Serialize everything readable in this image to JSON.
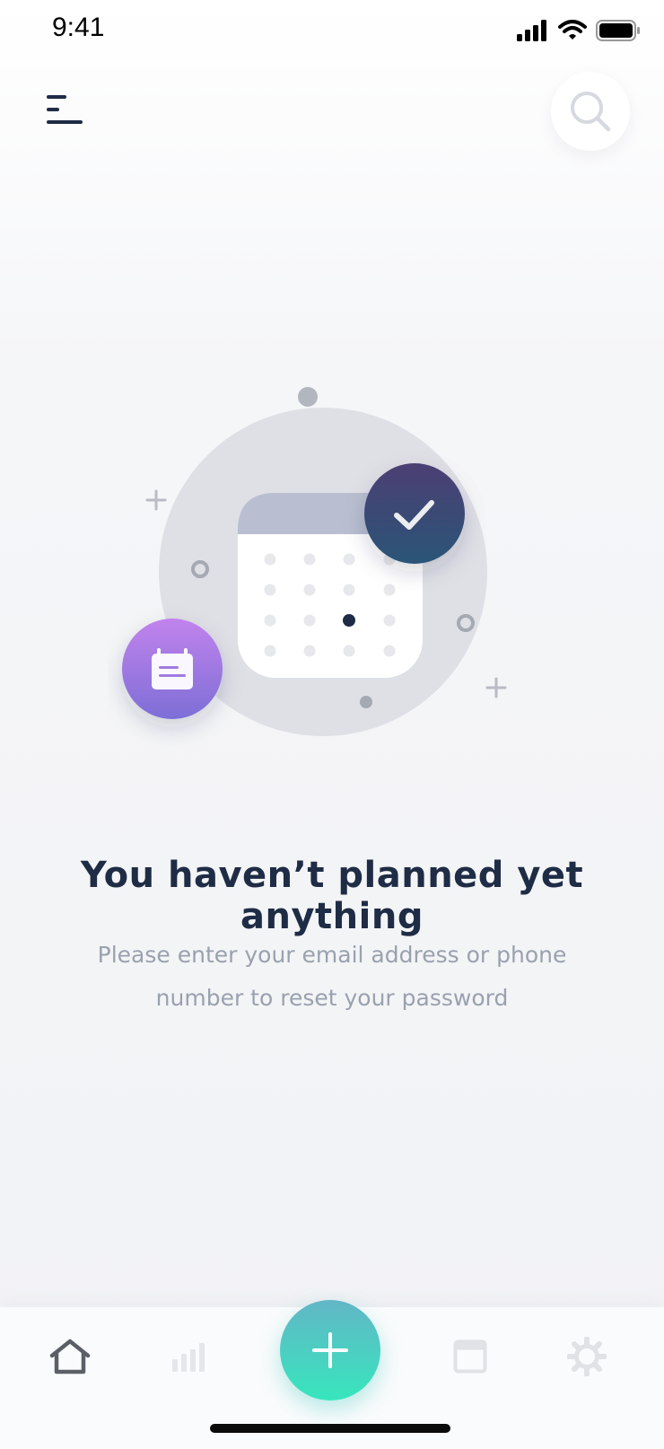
{
  "status_bar": {
    "time": "9:41"
  },
  "header": {
    "menu_icon": "hamburger-menu-icon",
    "search_icon": "search-icon"
  },
  "empty_state": {
    "title": "You haven’t planned yet anything",
    "subtitle": "Please enter your email address or phone number to reset your password",
    "illustration_icons": [
      "calendar-icon",
      "check-badge-icon",
      "note-badge-icon"
    ]
  },
  "tab_bar": {
    "tabs": [
      {
        "name": "home",
        "icon": "home-icon",
        "active": true
      },
      {
        "name": "stats",
        "icon": "bar-chart-icon",
        "active": false
      },
      {
        "name": "calendar",
        "icon": "calendar-window-icon",
        "active": false
      },
      {
        "name": "settings",
        "icon": "gear-icon",
        "active": false
      }
    ],
    "fab_icon": "plus-icon"
  },
  "colors": {
    "title": "#1f2c45",
    "subtitle": "#9aa1ae",
    "fab_gradient_start": "#62b6c6",
    "fab_gradient_end": "#37e6bd",
    "check_badge": "#3a4a78",
    "note_badge": "#a27ae0",
    "calendar_header": "#b9bfd0"
  }
}
